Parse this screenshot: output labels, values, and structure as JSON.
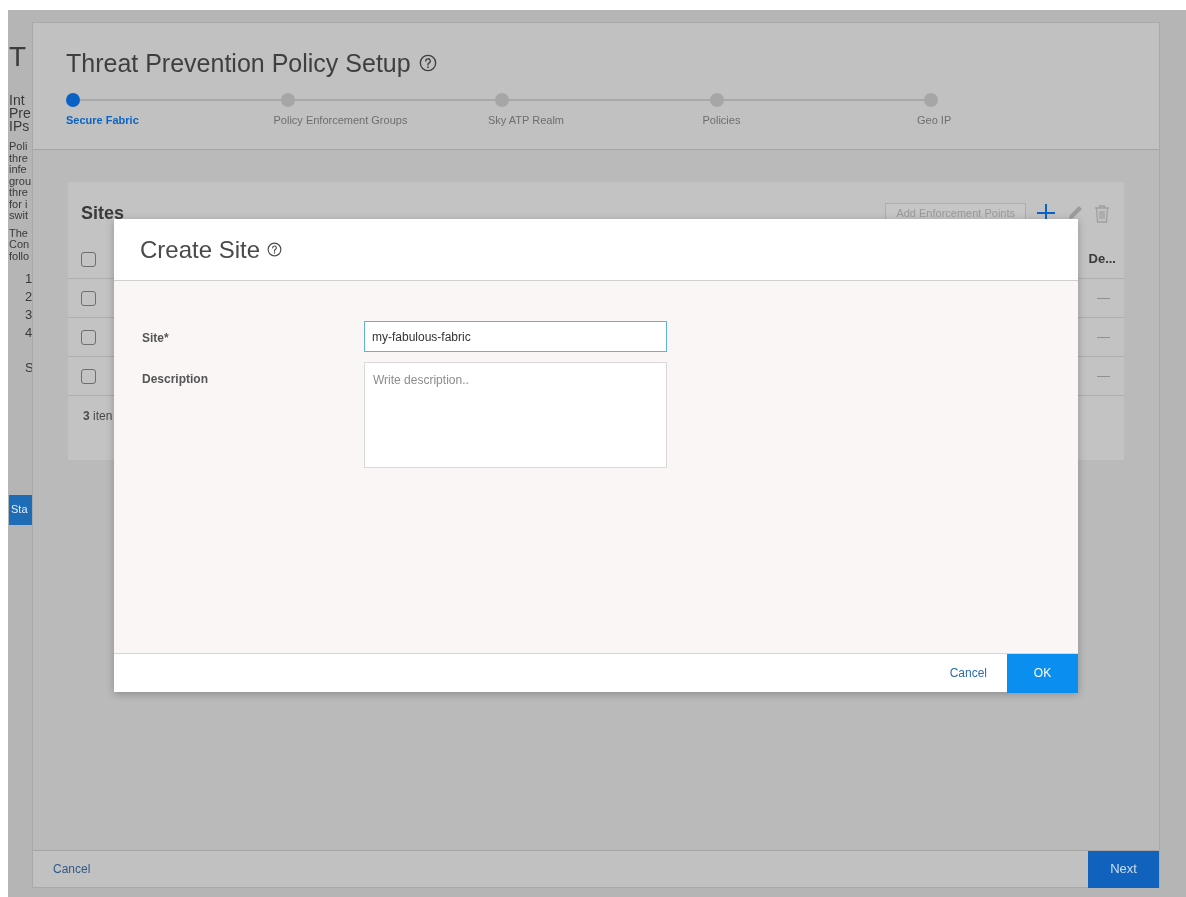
{
  "background_page": {
    "title": "T",
    "intro_lines": [
      "Int",
      "Pre",
      "IPs"
    ],
    "paragraph_lines": [
      "Poli",
      "thre",
      "infe",
      "grou",
      "thre",
      "for i",
      "swit"
    ],
    "paragraph2_lines": [
      "The",
      "Con",
      "follo"
    ],
    "numbered": [
      "1",
      "2",
      "3",
      "4"
    ],
    "extra": "S",
    "start_button": "Sta"
  },
  "wizard": {
    "title": "Threat Prevention Policy Setup",
    "steps": [
      {
        "label": "Secure Fabric",
        "selected": true
      },
      {
        "label": "Policy Enforcement Groups",
        "selected": false
      },
      {
        "label": "Sky ATP Realm",
        "selected": false
      },
      {
        "label": "Policies",
        "selected": false
      },
      {
        "label": "Geo IP",
        "selected": false
      }
    ],
    "sites": {
      "title": "Sites",
      "add_button": "Add Enforcement Points",
      "header_checkbox": {
        "checked": false
      },
      "column_header": "De...",
      "rows": [
        {
          "checked": false,
          "description": "—"
        },
        {
          "checked": false,
          "description": "—"
        },
        {
          "checked": false,
          "description": "—"
        }
      ],
      "footer": "**3** iten"
    },
    "cancel": "Cancel",
    "next": "Next"
  },
  "dialog": {
    "title": "Create Site",
    "fields": [
      {
        "kind": "input",
        "label": "Site*",
        "value": "my-fabulous-fabric"
      },
      {
        "kind": "textarea",
        "label": "Description",
        "placeholder": "Write description.."
      }
    ],
    "cancel": "Cancel",
    "ok": "OK"
  }
}
